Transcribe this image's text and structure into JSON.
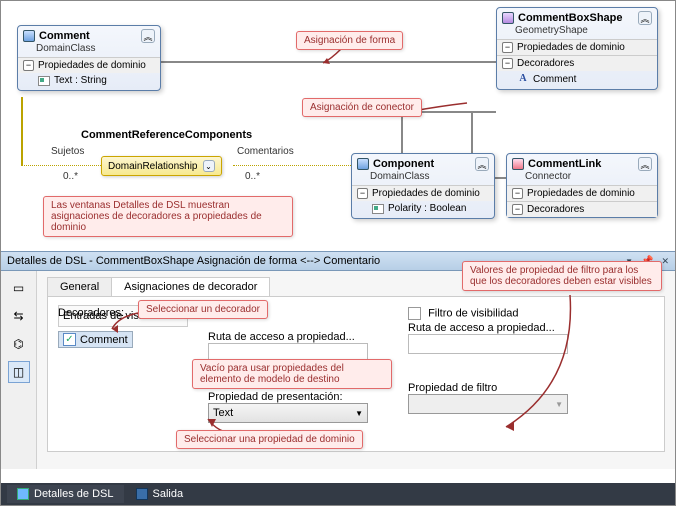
{
  "boxes": {
    "comment": {
      "title": "Comment",
      "sub": "DomainClass",
      "section": "Propiedades de dominio",
      "item": "Text : String"
    },
    "component": {
      "title": "Component",
      "sub": "DomainClass",
      "section": "Propiedades de dominio",
      "item": "Polarity : Boolean"
    },
    "commentBoxShape": {
      "title": "CommentBoxShape",
      "sub": "GeometryShape",
      "section1": "Propiedades de dominio",
      "section2": "Decoradores",
      "item": "Comment"
    },
    "commentLink": {
      "title": "CommentLink",
      "sub": "Connector",
      "section1": "Propiedades de dominio",
      "section2": "Decoradores"
    }
  },
  "relationship": {
    "title": "CommentReferenceComponents",
    "left_label": "Sujetos",
    "right_label": "Comentarios",
    "left_mult": "0..*",
    "right_mult": "0..*",
    "box": "DomainRelationship"
  },
  "callouts": {
    "shape_map": "Asignación de forma",
    "connector_map": "Asignación de conector",
    "dsl_note": "Las ventanas Detalles de DSL muestran asignaciones de decoradores a propiedades de dominio",
    "select_decorator": "Seleccionar un decorador",
    "empty_for_target": "Vacío para usar propiedades del elemento de modelo de destino",
    "select_domain_prop": "Seleccionar una propiedad de dominio",
    "filter_values": "Valores de propiedad de filtro para los que los decoradores deben estar visibles"
  },
  "details": {
    "title": "Detalles de DSL - CommentBoxShape Asignación de forma <--> Comentario",
    "tab_general": "General",
    "tab_decor": "Asignaciones de decorador",
    "decoradores_label": "Decoradores:",
    "list_item": "Comment",
    "path_to_prop": "Ruta de acceso a propiedad...",
    "display_prop": "Propiedad de presentación:",
    "display_prop_value": "Text",
    "vis_filter": "Filtro de visibilidad",
    "filter_path": "Ruta de acceso a propiedad...",
    "filter_prop": "Propiedad de filtro",
    "vis_entries": "Entradas de visibilidad:"
  },
  "status": {
    "dsl": "Detalles de DSL",
    "output": "Salida"
  }
}
